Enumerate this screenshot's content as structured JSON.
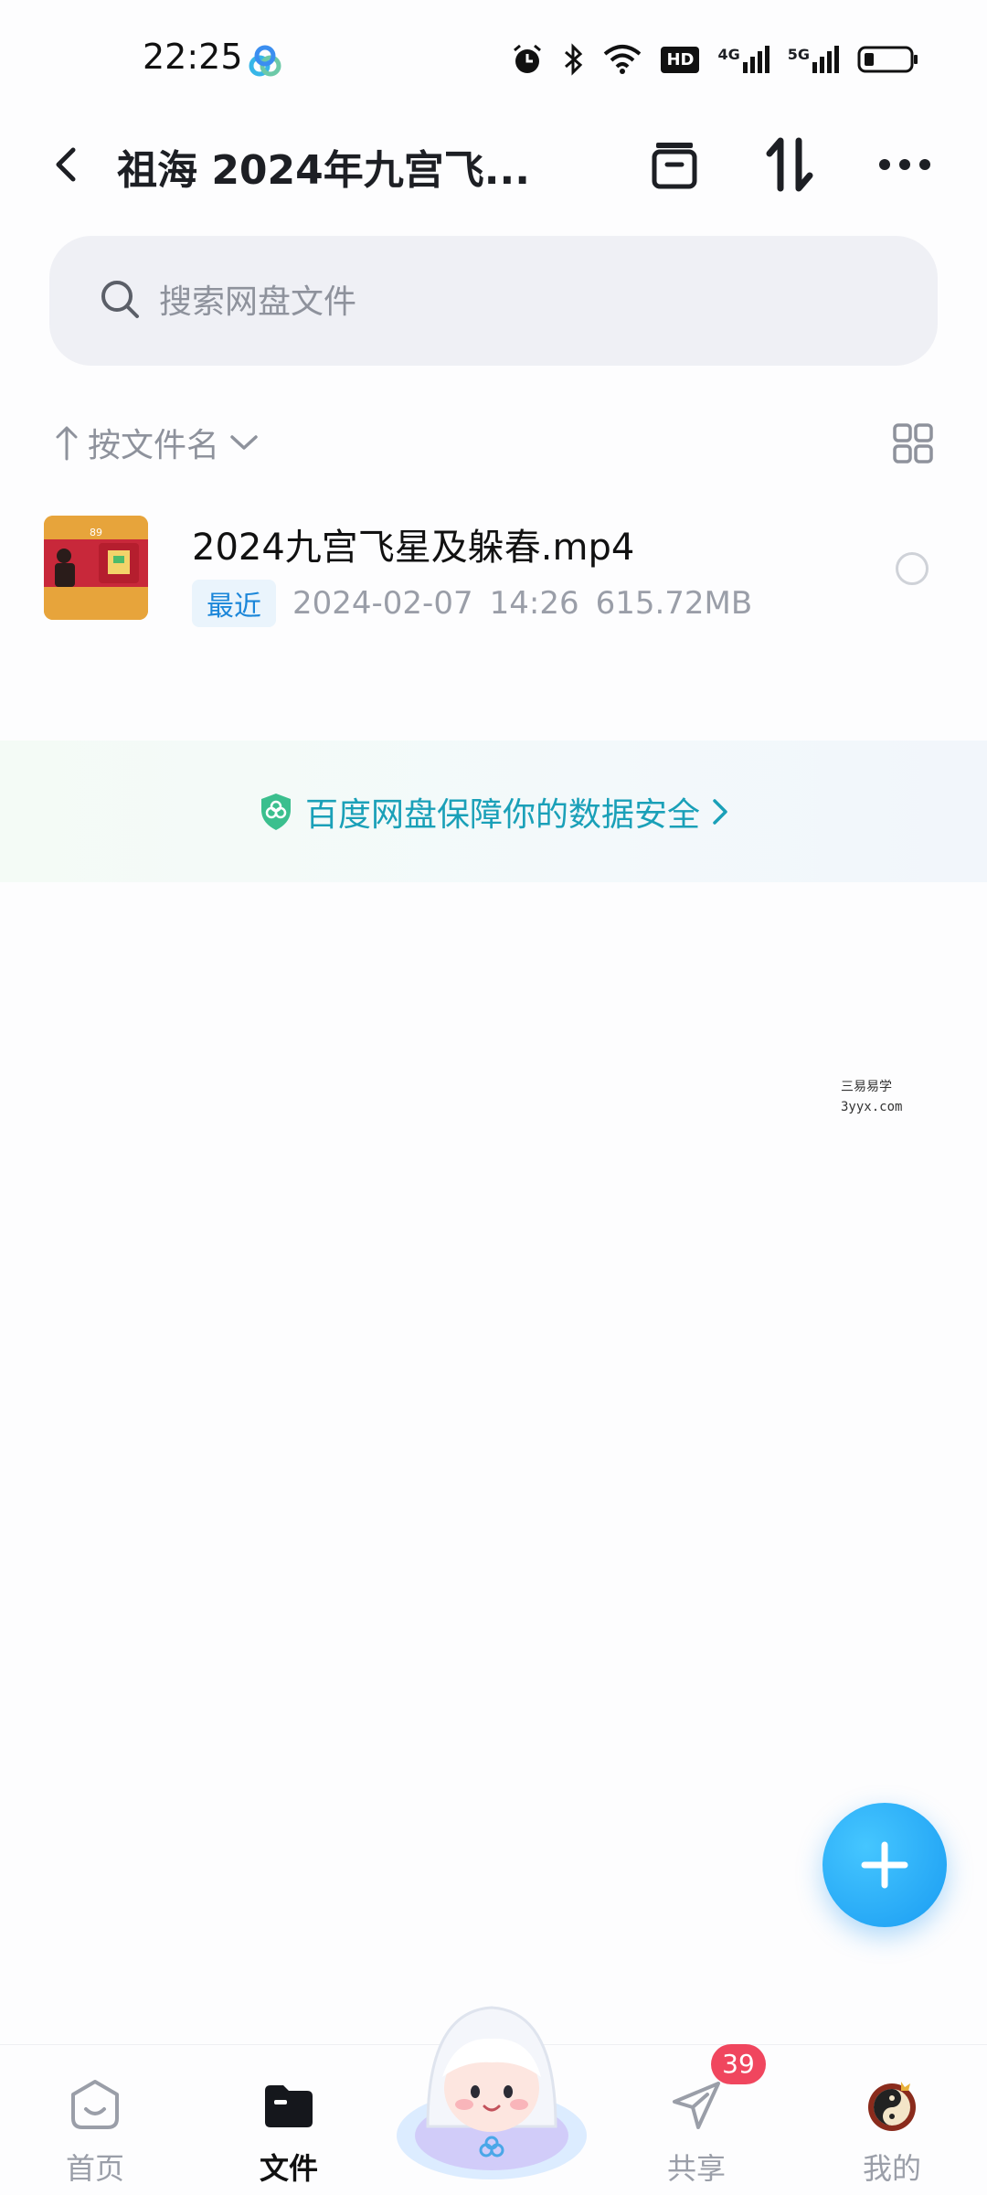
{
  "status_bar": {
    "time": "22:25",
    "icons": [
      "app-icon",
      "alarm-icon",
      "bluetooth-icon",
      "wifi-icon",
      "hd-icon",
      "signal-4g-icon",
      "signal-5g-icon",
      "battery-icon"
    ],
    "hd_label": "HD",
    "net1_label": "4G",
    "net2_label": "5G"
  },
  "header": {
    "title": "祖海 2024年九宫飞...",
    "actions": [
      "archive-icon",
      "transfer-icon",
      "more-icon"
    ]
  },
  "search": {
    "placeholder": "搜索网盘文件",
    "value": ""
  },
  "sort": {
    "label": "按文件名",
    "view_icon": "grid-view-icon"
  },
  "files": [
    {
      "name": "2024九宫飞星及躲春.mp4",
      "badge": "最近",
      "date": "2024-02-07",
      "time": "14:26",
      "size": "615.72MB",
      "thumbnail_label": "89"
    }
  ],
  "safety_banner": {
    "text": "百度网盘保障你的数据安全"
  },
  "watermark": {
    "line1": "三易易学",
    "line2": "3yyx.com"
  },
  "bottom_nav": {
    "items": [
      {
        "label": "首页",
        "icon": "home-icon"
      },
      {
        "label": "文件",
        "icon": "folder-icon",
        "active": true
      },
      {
        "label": "",
        "icon": "mascot-icon"
      },
      {
        "label": "共享",
        "icon": "share-icon",
        "badge": "39"
      },
      {
        "label": "我的",
        "icon": "avatar-icon"
      }
    ]
  },
  "colors": {
    "accent": "#1a9cf2",
    "badge_red": "#f0465e",
    "safe_text": "#1aa0b8"
  }
}
